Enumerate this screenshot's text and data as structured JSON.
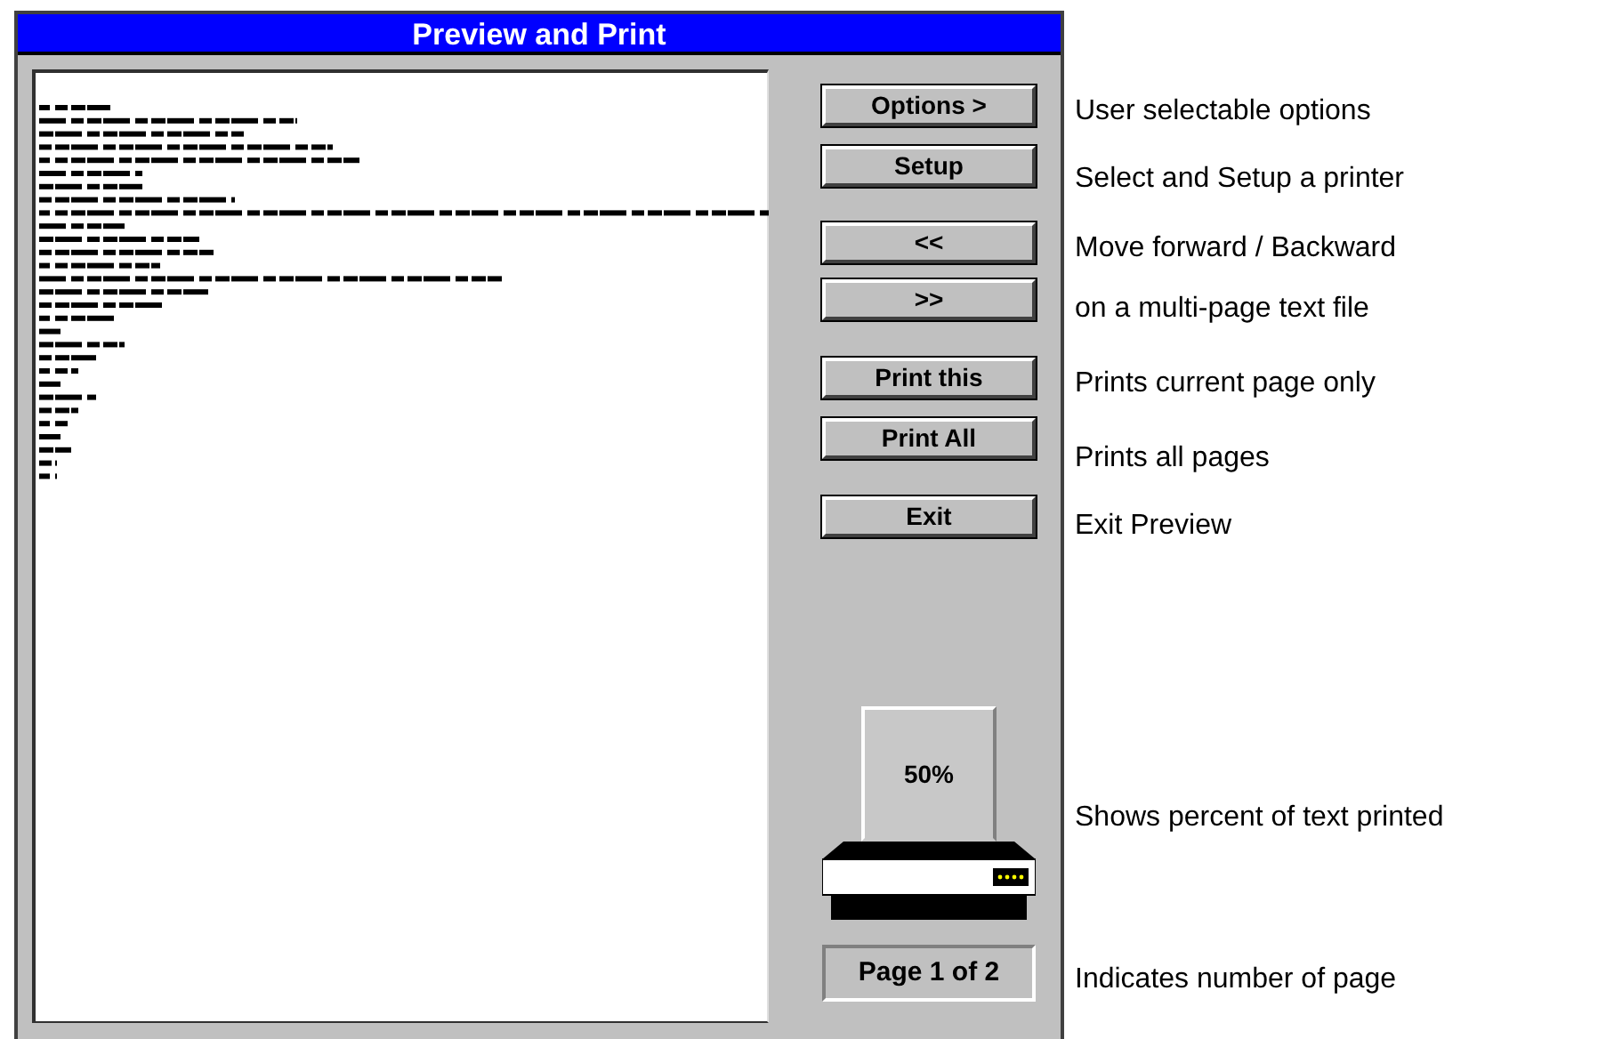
{
  "window": {
    "title": "Preview and Print"
  },
  "buttons": [
    {
      "label": "Options >"
    },
    {
      "label": "Setup"
    },
    {
      "label": "<<"
    },
    {
      "label": ">>"
    },
    {
      "label": "Print this"
    },
    {
      "label": "Print All"
    },
    {
      "label": "Exit"
    }
  ],
  "printer": {
    "percent": "50%"
  },
  "page_indicator": "Page 1 of 2",
  "annotations": [
    "User selectable options",
    "Select and Setup a printer",
    "Move forward / Backward",
    "on a multi-page text file",
    "Prints current page only",
    "Prints all pages",
    "Exit Preview",
    "Shows percent of text printed",
    "Indicates number of page"
  ]
}
